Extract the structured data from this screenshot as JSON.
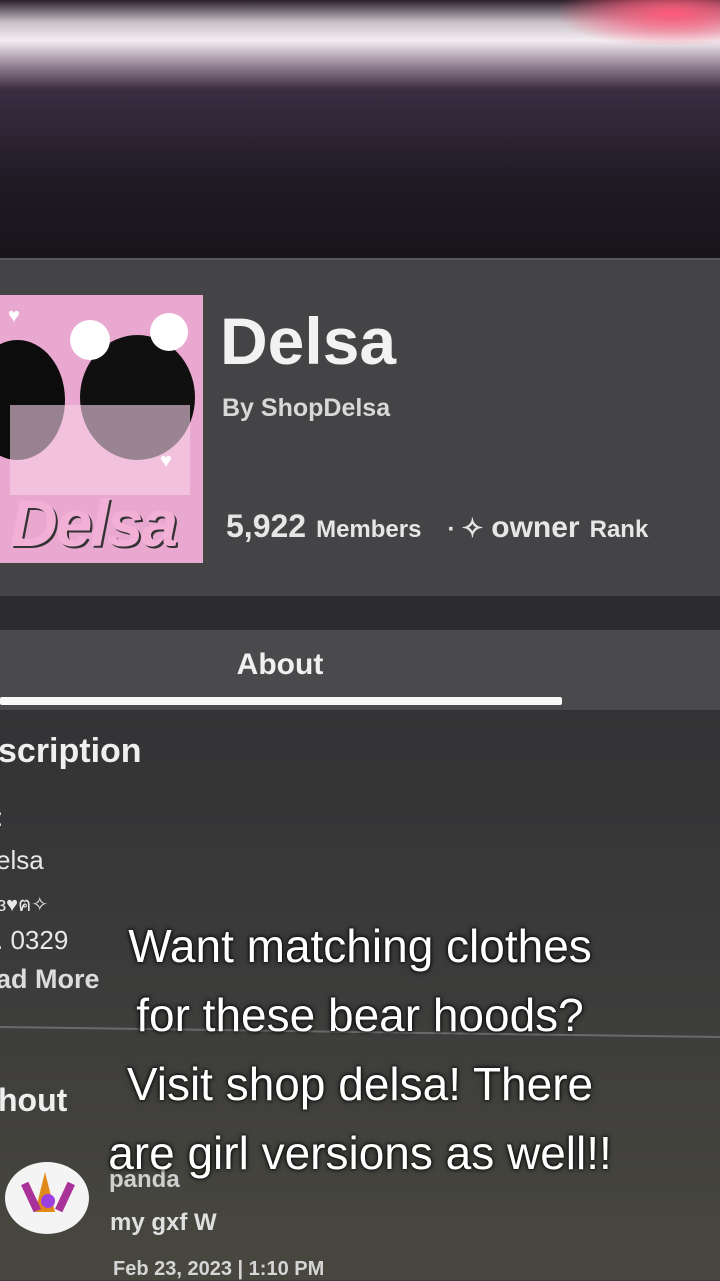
{
  "group": {
    "name": "Delsa",
    "creator": "By ShopDelsa",
    "image_text": "Delsa",
    "member_count": "5,922",
    "members_label": "Members",
    "separator": "·",
    "rank_icon": "✧",
    "rank_name": "owner",
    "rank_label": "Rank"
  },
  "tabs": [
    {
      "label": "About"
    }
  ],
  "description": {
    "heading": "scription",
    "lines": [
      ":",
      "elsa",
      "ɞ♥︎ฅ✧",
      ". 0329"
    ],
    "read_more": "ad More"
  },
  "shout": {
    "heading": "hout",
    "user": "panda",
    "text": "my gxf W",
    "date": "Feb 23, 2023 | 1:10 PM"
  },
  "caption": {
    "lines": [
      "Want matching clothes",
      "for these bear hoods?",
      "Visit shop delsa! There",
      "are girl versions as well!!"
    ]
  },
  "colors": {
    "background": "#3a3a3c",
    "card": "#444446",
    "tab_underline": "#f7f7f7",
    "image_pink": "#e9a8cf"
  },
  "icons": [
    "owner-rank-diamond-icon",
    "group-logo-image",
    "user-avatar"
  ]
}
